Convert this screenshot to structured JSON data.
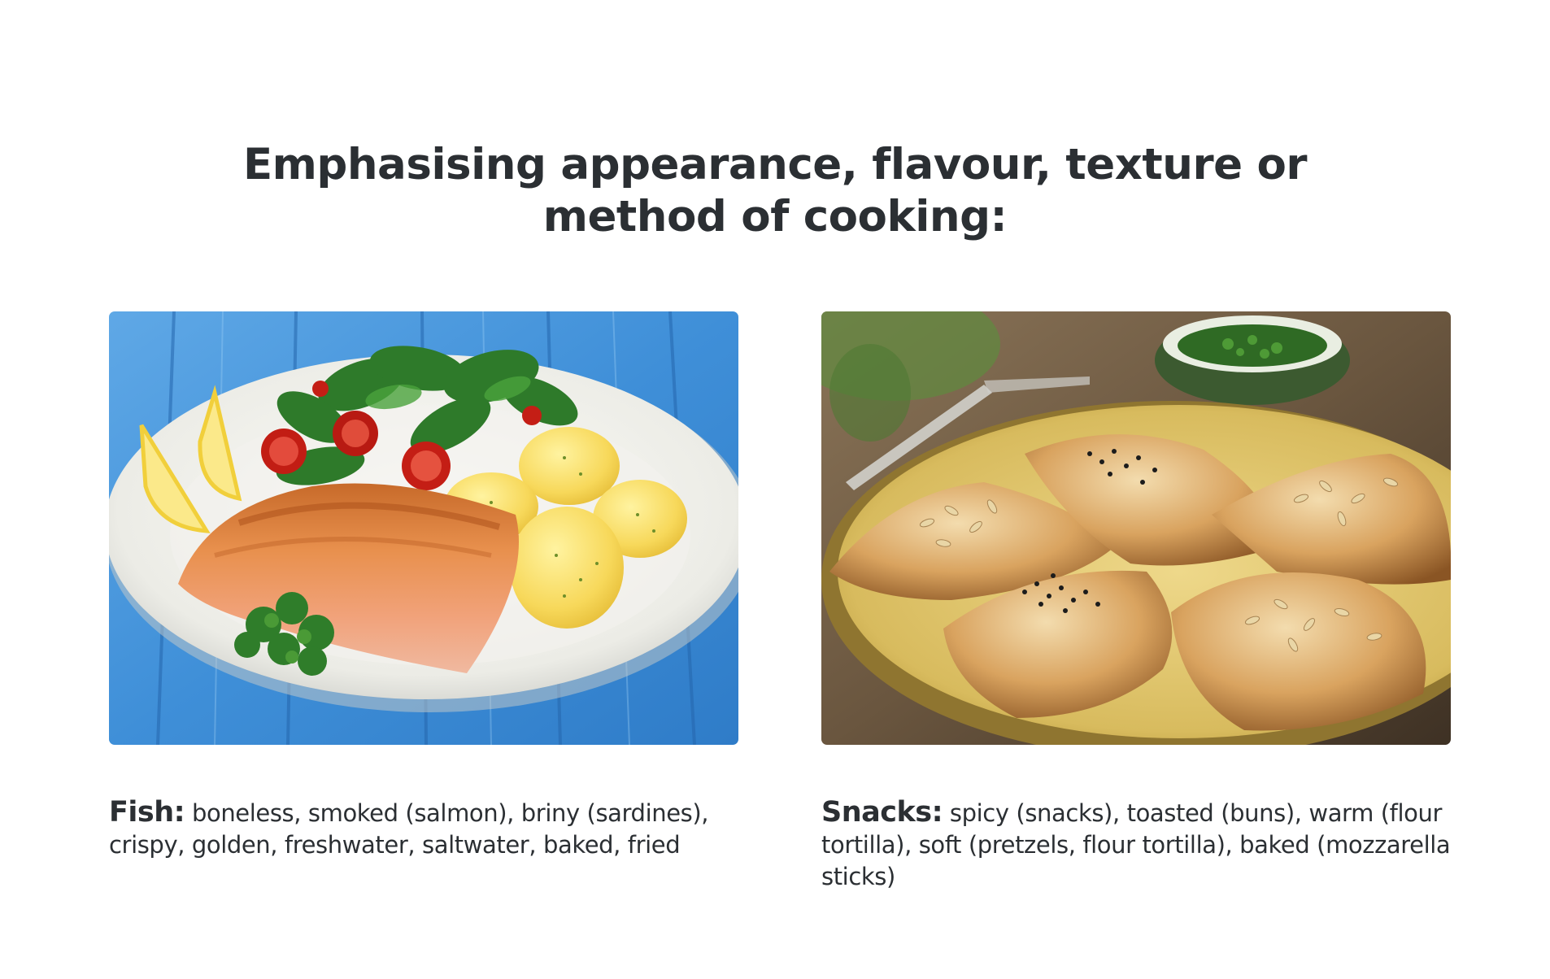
{
  "title": {
    "line1": "Emphasising appearance, flavour, texture or",
    "line2": "method of cooking:"
  },
  "cards": [
    {
      "image_alt": "Fried salmon fillet with boiled potatoes, lemon wedges, parsley and salad on a white plate on a blue wooden table",
      "lead": "Fish:",
      "text": " boneless, smoked (salmon), briny (sardines), crispy, golden, freshwater, saltwater, baked, fried"
    },
    {
      "image_alt": "Baked puff pastry snacks topped with sunflower and black sesame seeds on a yellow plate",
      "lead": "Snacks:",
      "text": " spicy (snacks), toasted (buns), warm (flour tortilla), soft (pretzels, flour tortilla), baked (mozzarella sticks)"
    }
  ]
}
